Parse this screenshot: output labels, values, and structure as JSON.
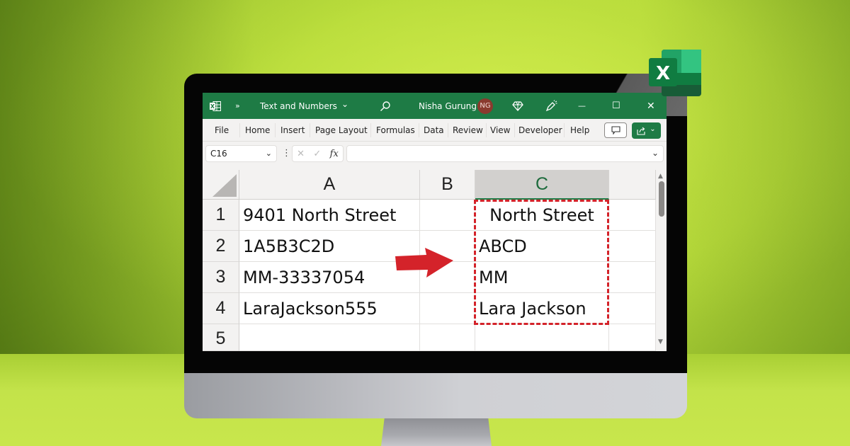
{
  "titlebar": {
    "more_label": "»",
    "file_title": "Text and Numbers",
    "title_chevron": "⌄",
    "user_name": "Nisha Gurung",
    "user_initials": "NG",
    "minimize_glyph": "—",
    "maximize_glyph": "☐",
    "close_glyph": "✕"
  },
  "ribbon": {
    "tabs": [
      "File",
      "Home",
      "Insert",
      "Page Layout",
      "Formulas",
      "Data",
      "Review",
      "View",
      "Developer",
      "Help"
    ],
    "share_chevron": "⌄"
  },
  "formula_bar": {
    "name_box": "C16",
    "name_chevron": "⌄",
    "dots": "⋮",
    "cancel_glyph": "✕",
    "enter_glyph": "✓",
    "fx_label": "fx",
    "formula_value": "",
    "expand_chevron": "⌄"
  },
  "sheet": {
    "columns": [
      "A",
      "B",
      "C"
    ],
    "selected_column": "C",
    "rows": [
      {
        "num": "1",
        "A": "9401 North Street",
        "B": "",
        "C": "North Street"
      },
      {
        "num": "2",
        "A": "1A5B3C2D",
        "B": "",
        "C": "ABCD"
      },
      {
        "num": "3",
        "A": "MM-33337054",
        "B": "",
        "C": "MM"
      },
      {
        "num": "4",
        "A": "LaraJackson555",
        "B": "",
        "C": "Lara Jackson"
      },
      {
        "num": "5",
        "A": "",
        "B": "",
        "C": ""
      }
    ]
  },
  "colors": {
    "excel_green": "#1e7b45",
    "highlight_red": "#d4232a",
    "background_lime": "#c3e34a"
  },
  "badge_letter": "X"
}
